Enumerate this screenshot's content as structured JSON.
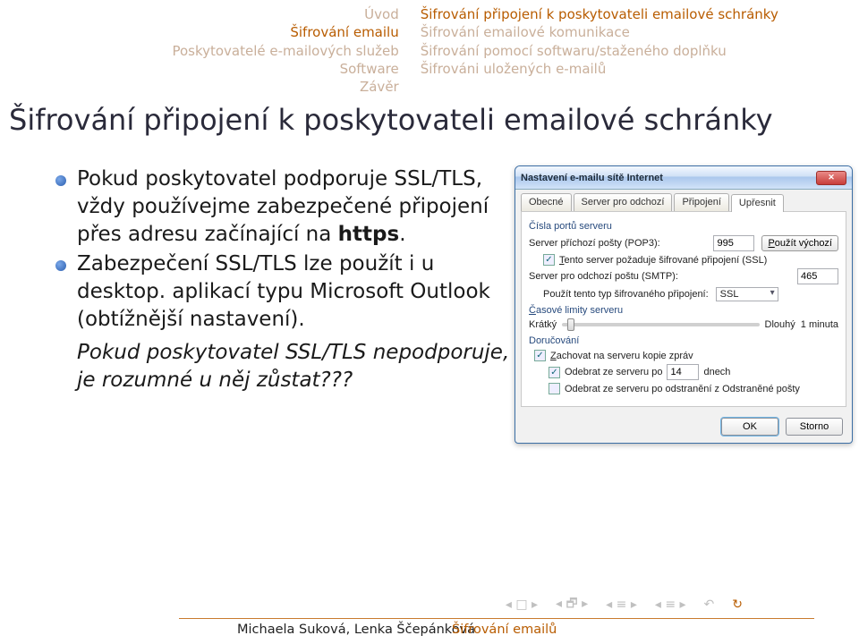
{
  "header": {
    "left": {
      "l1": "Úvod",
      "l2": "Šifrování emailu",
      "l3": "Poskytovatelé e-mailových služeb",
      "l4": "Software",
      "l5": "Závěr"
    },
    "right": {
      "r1": "Šifrování připojení k poskytovateli emailové schránky",
      "r2": "Šifrování emailové komunikace",
      "r3": "Šifrování pomocí softwaru/staženého doplňku",
      "r4": "Šifrováni uložených e-mailů"
    }
  },
  "title": "Šifrování připojení k poskytovateli emailové schránky",
  "bullets": {
    "b1a": "Pokud poskytovatel podporuje SSL/TLS, vždy používejme zabezpečené připojení přes adresu začínající na ",
    "b1b": "https",
    "b1c": ".",
    "b2": "Zabezpečení SSL/TLS lze použít i u desktop. aplikací typu Microsoft Outlook (obtížnější nastavení).",
    "note": "Pokud poskytovatel SSL/TLS nepodporuje, je rozumné u něj zůstat???"
  },
  "dialog": {
    "title": "Nastavení e-mailu sítě Internet",
    "tabs": {
      "t1": "Obecné",
      "t2": "Server pro odchozí",
      "t3": "Připojení",
      "t4": "Upřesnit"
    },
    "grp_ports": "Čísla portů serveru",
    "pop3_label": "Server příchozí pošty (POP3):",
    "pop3_value": "995",
    "default_btn": "Použít výchozí",
    "ssl_incoming": "Tento server požaduje šifrované připojení (SSL)",
    "smtp_label": "Server pro odchozí poštu (SMTP):",
    "smtp_value": "465",
    "enc_type_label": "Použít tento typ šifrovaného připojení:",
    "enc_type_value": "SSL",
    "grp_timeout": "Časové limity serveru",
    "short": "Krátký",
    "long": "Dlouhý",
    "minute": "1 minuta",
    "grp_delivery": "Doručování",
    "keep_copy": "Zachovat na serveru kopie zpráv",
    "remove_after": "Odebrat ze serveru po",
    "days_value": "14",
    "days_label": "dnech",
    "remove_deleted": "Odebrat ze serveru po odstranění z Odstraněné pošty",
    "ok": "OK",
    "cancel": "Storno"
  },
  "footer": {
    "authors": "Michaela Suková, Lenka Ščepánková",
    "topic": "Šifrování emailů"
  }
}
